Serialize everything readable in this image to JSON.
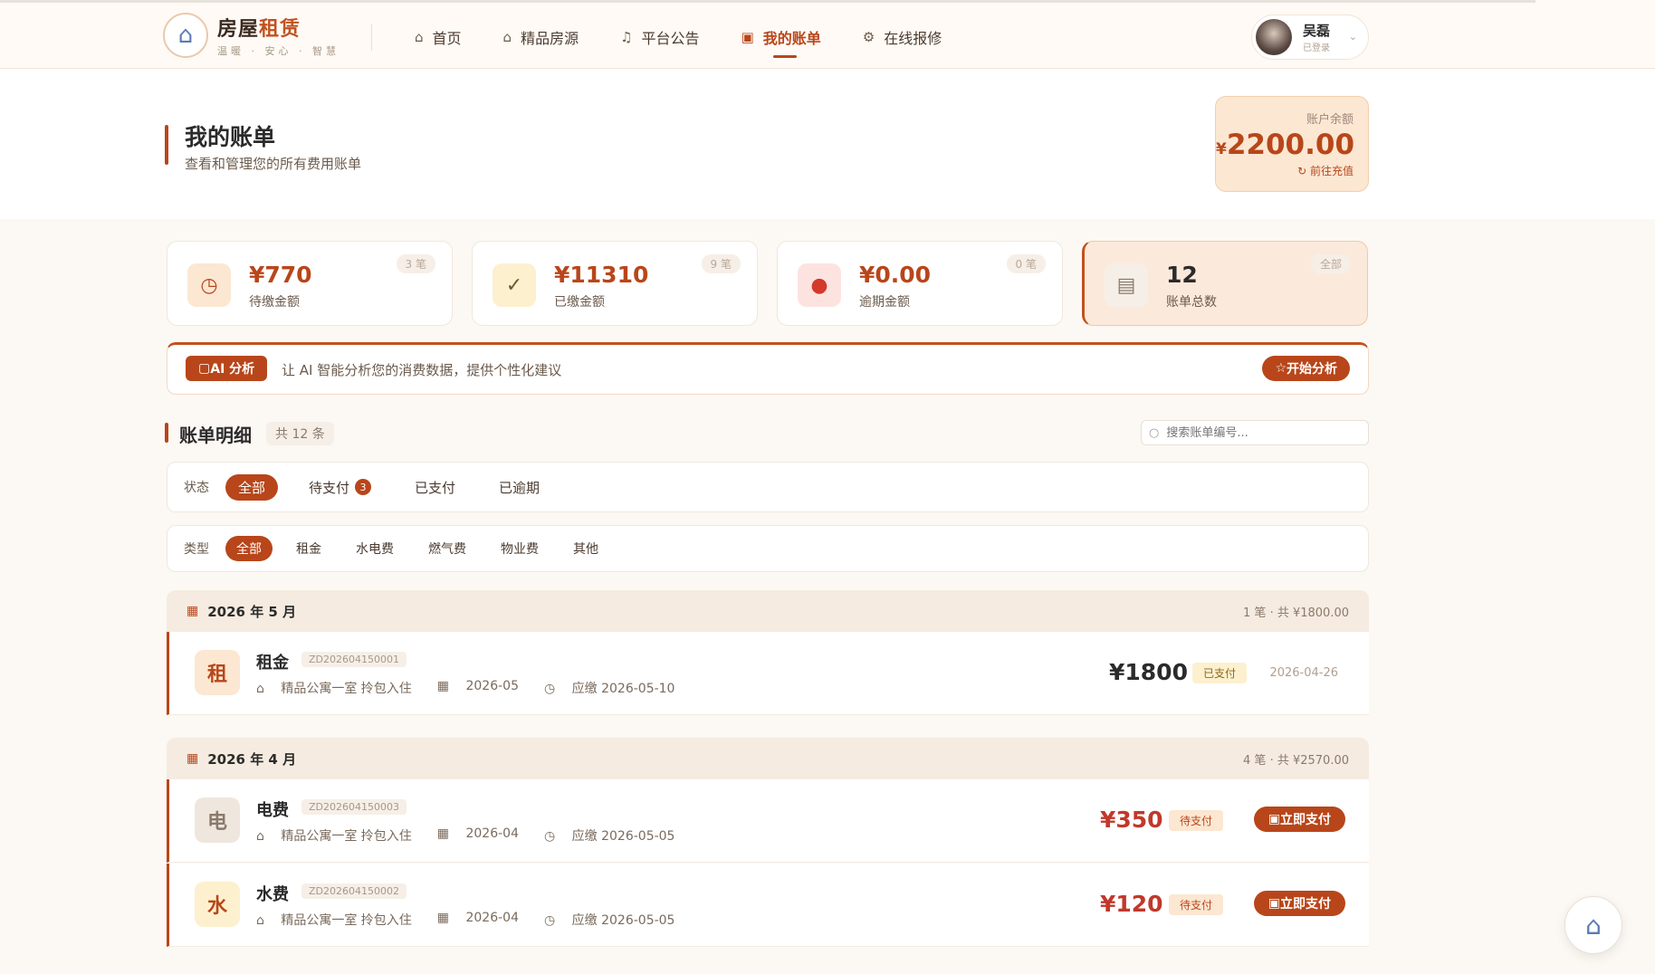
{
  "app": {
    "title_plain": "房屋",
    "title_accent": "租赁",
    "slogan": "温暖 · 安心 · 智慧"
  },
  "nav": [
    {
      "label": "首页",
      "icon": "home-icon",
      "active": false
    },
    {
      "label": "精品房源",
      "icon": "house-icon",
      "active": false
    },
    {
      "label": "平台公告",
      "icon": "bell-icon",
      "active": false
    },
    {
      "label": "我的账单",
      "icon": "folder-icon",
      "active": true
    },
    {
      "label": "在线报修",
      "icon": "gear-icon",
      "active": false
    }
  ],
  "user": {
    "name": "吴磊",
    "status": "已登录"
  },
  "page": {
    "title": "我的账单",
    "subtitle": "查看和管理您的所有费用账单"
  },
  "balance": {
    "label": "账户余额",
    "currency": "¥",
    "value": "2200.00",
    "action": "前往充值"
  },
  "stats": [
    {
      "value": "¥770",
      "label": "待缴金额",
      "badge": "3 笔",
      "icon": "clock-icon",
      "icon_bg": "#fbe7d2",
      "icon_color": "#b8461a"
    },
    {
      "value": "¥11310",
      "label": "已缴金额",
      "badge": "9 笔",
      "icon": "check-circle-icon",
      "icon_bg": "#fdf0cf",
      "icon_color": "#6b5a2c"
    },
    {
      "value": "¥0.00",
      "label": "逾期金额",
      "badge": "0 笔",
      "icon": "alert-icon",
      "icon_bg": "#fde3e0",
      "icon_color": "#d23a2a"
    },
    {
      "value": "12",
      "label": "账单总数",
      "badge": "全部",
      "icon": "document-icon",
      "icon_bg": "#f6efe8",
      "icon_color": "#8a7a6c"
    }
  ],
  "ai": {
    "tag": "AI 分析",
    "text": "让 AI 智能分析您的消费数据，提供个性化建议",
    "button": "开始分析"
  },
  "section": {
    "title": "账单明细",
    "count": "共 12 条",
    "search_placeholder": "搜索账单编号..."
  },
  "status_filter": {
    "label": "状态",
    "options": [
      "全部",
      "待支付",
      "已支付",
      "已逾期"
    ],
    "active": 0,
    "pending_badge": "3"
  },
  "type_filter": {
    "label": "类型",
    "options": [
      "全部",
      "租金",
      "水电费",
      "燃气费",
      "物业费",
      "其他"
    ],
    "active": 0
  },
  "groups": [
    {
      "title": "2026 年 5 月",
      "summary": "1 笔 · 共 ¥1800.00",
      "bills": [
        {
          "char": "租",
          "name": "租金",
          "no": "ZD202604150001",
          "property": "精品公寓一室 拎包入住",
          "period": "2026-05",
          "due": "应缴 2026-05-10",
          "amount": "¥1800",
          "status": "已支付",
          "paid_date": "2026-04-26",
          "pay_label": ""
        }
      ]
    },
    {
      "title": "2026 年 4 月",
      "summary": "4 笔 · 共 ¥2570.00",
      "bills": [
        {
          "char": "电",
          "name": "电费",
          "no": "ZD202604150003",
          "property": "精品公寓一室 拎包入住",
          "period": "2026-04",
          "due": "应缴 2026-05-05",
          "amount": "¥350",
          "status": "待支付",
          "paid_date": "",
          "pay_label": "立即支付"
        },
        {
          "char": "水",
          "name": "水费",
          "no": "ZD202604150002",
          "property": "精品公寓一室 拎包入住",
          "period": "2026-04",
          "due": "应缴 2026-05-05",
          "amount": "¥120",
          "status": "待支付",
          "paid_date": "",
          "pay_label": "立即支付"
        }
      ]
    }
  ],
  "colors": {
    "accent": "#b8461a",
    "paid_tag_bg": "#fdf0cf",
    "pending_tag_bg": "#fbe7d2"
  }
}
